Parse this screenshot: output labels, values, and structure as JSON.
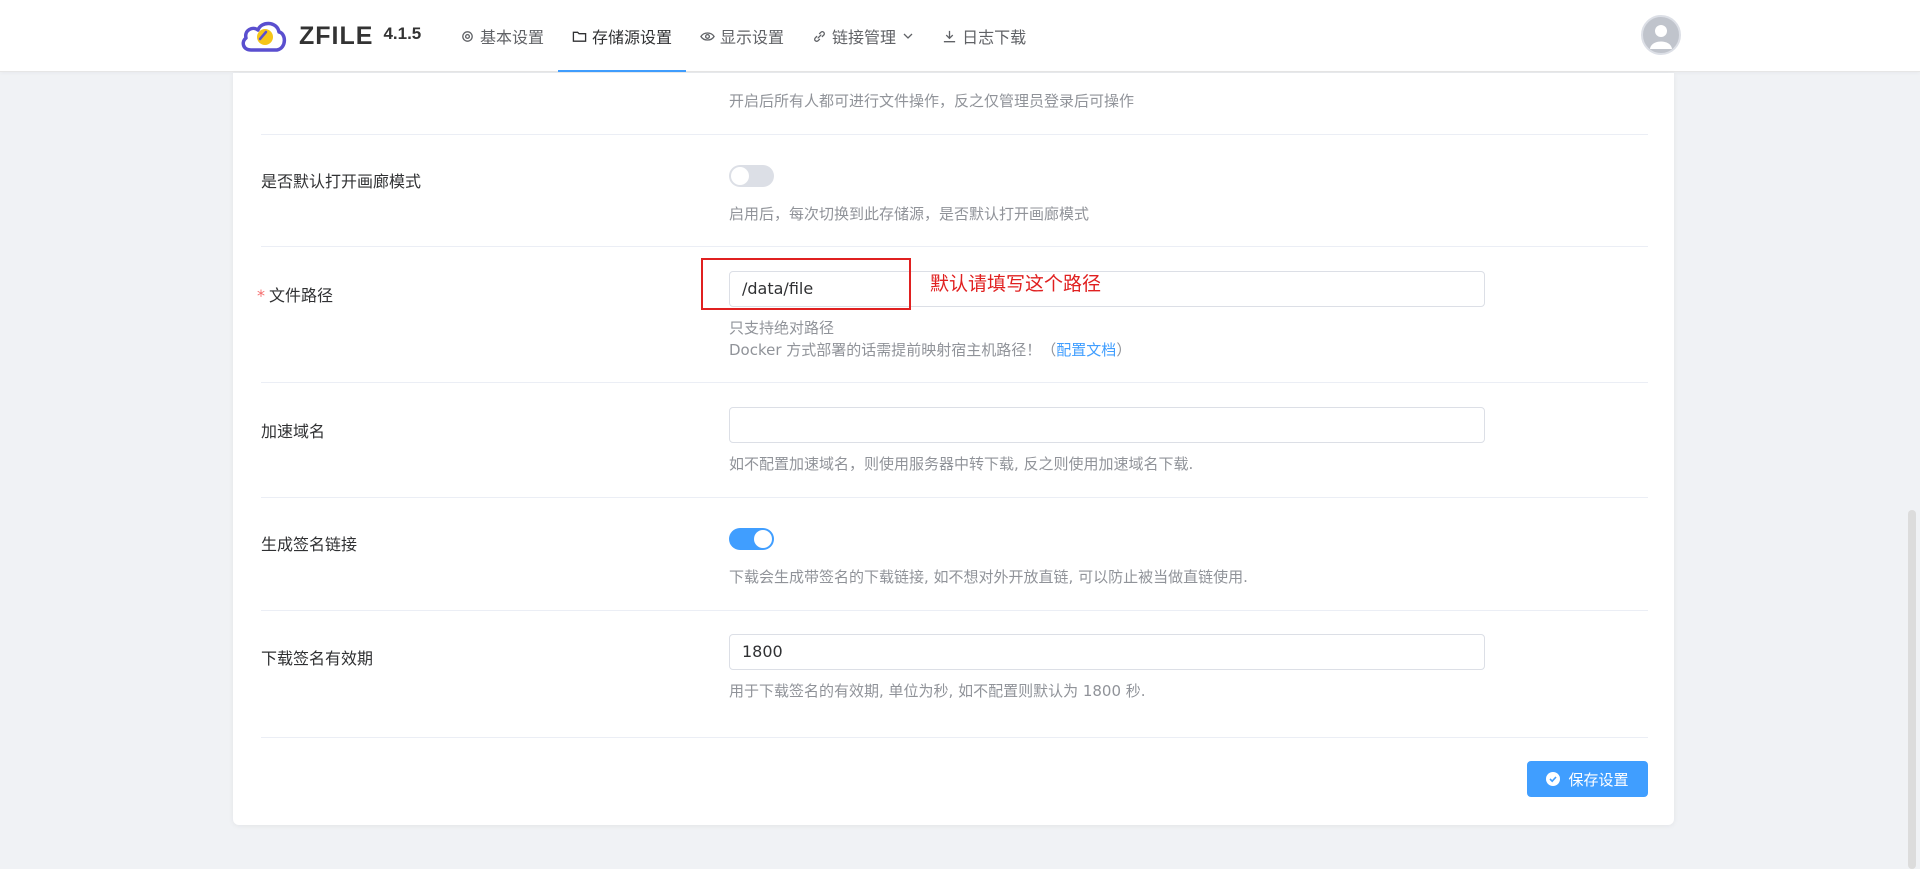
{
  "header": {
    "brand": "ZFILE",
    "version": "4.1.5",
    "nav": [
      {
        "label": "基本设置",
        "icon": "gear-icon"
      },
      {
        "label": "存储源设置",
        "icon": "folder-icon"
      },
      {
        "label": "显示设置",
        "icon": "eye-icon"
      },
      {
        "label": "链接管理",
        "icon": "link-icon"
      },
      {
        "label": "日志下载",
        "icon": "download-icon"
      }
    ],
    "active_nav": "存储源设置"
  },
  "form": {
    "top_hint": "开启后所有人都可进行文件操作，反之仅管理员登录后可操作",
    "gallery": {
      "label": "是否默认打开画廊模式",
      "enabled": false,
      "hint": "启用后，每次切换到此存储源，是否默认打开画廊模式"
    },
    "file_path": {
      "label": "文件路径",
      "value": "/data/file",
      "hint1": "只支持绝对路径",
      "hint2": "Docker 方式部署的话需提前映射宿主机路径！（",
      "hint_link": "配置文档",
      "hint_close": "）",
      "annotation": "默认请填写这个路径"
    },
    "domain": {
      "label": "加速域名",
      "value": "",
      "hint": "如不配置加速域名，则使用服务器中转下载, 反之则使用加速域名下载."
    },
    "sign_link": {
      "label": "生成签名链接",
      "enabled": true,
      "hint": "下载会生成带签名的下载链接, 如不想对外开放直链, 可以防止被当做直链使用."
    },
    "sign_expire": {
      "label": "下载签名有效期",
      "value": "1800",
      "hint": "用于下载签名的有效期, 单位为秒, 如不配置则默认为 1800 秒."
    },
    "save_label": "保存设置"
  },
  "colors": {
    "primary": "#409eff",
    "annotation": "#e02020",
    "required": "#f56c6c"
  }
}
